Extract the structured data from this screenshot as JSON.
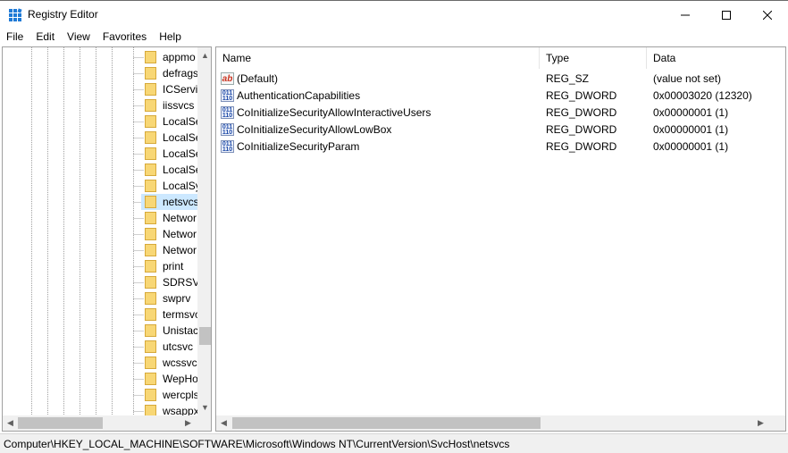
{
  "window": {
    "title": "Registry Editor"
  },
  "menu": [
    "File",
    "Edit",
    "View",
    "Favorites",
    "Help"
  ],
  "tree": {
    "items": [
      {
        "label": "appmo",
        "selected": false
      },
      {
        "label": "defrags",
        "selected": false
      },
      {
        "label": "ICServic",
        "selected": false
      },
      {
        "label": "iissvcs",
        "selected": false
      },
      {
        "label": "LocalSe",
        "selected": false
      },
      {
        "label": "LocalSe",
        "selected": false
      },
      {
        "label": "LocalSe",
        "selected": false
      },
      {
        "label": "LocalSe",
        "selected": false
      },
      {
        "label": "LocalSy",
        "selected": false
      },
      {
        "label": "netsvcs",
        "selected": true
      },
      {
        "label": "Networ",
        "selected": false
      },
      {
        "label": "Networ",
        "selected": false
      },
      {
        "label": "Networ",
        "selected": false
      },
      {
        "label": "print",
        "selected": false
      },
      {
        "label": "SDRSVC",
        "selected": false
      },
      {
        "label": "swprv",
        "selected": false
      },
      {
        "label": "termsvc",
        "selected": false
      },
      {
        "label": "Unistac",
        "selected": false
      },
      {
        "label": "utcsvc",
        "selected": false
      },
      {
        "label": "wcssvc",
        "selected": false
      },
      {
        "label": "WepHo",
        "selected": false
      },
      {
        "label": "wercpls",
        "selected": false
      },
      {
        "label": "wsappx",
        "selected": false
      }
    ]
  },
  "list": {
    "columns": [
      "Name",
      "Type",
      "Data"
    ],
    "rows": [
      {
        "icon": "string-value-icon",
        "name": "(Default)",
        "type": "REG_SZ",
        "data": "(value not set)"
      },
      {
        "icon": "binary-value-icon",
        "name": "AuthenticationCapabilities",
        "type": "REG_DWORD",
        "data": "0x00003020 (12320)"
      },
      {
        "icon": "binary-value-icon",
        "name": "CoInitializeSecurityAllowInteractiveUsers",
        "type": "REG_DWORD",
        "data": "0x00000001 (1)"
      },
      {
        "icon": "binary-value-icon",
        "name": "CoInitializeSecurityAllowLowBox",
        "type": "REG_DWORD",
        "data": "0x00000001 (1)"
      },
      {
        "icon": "binary-value-icon",
        "name": "CoInitializeSecurityParam",
        "type": "REG_DWORD",
        "data": "0x00000001 (1)"
      }
    ]
  },
  "status": {
    "path": "Computer\\HKEY_LOCAL_MACHINE\\SOFTWARE\\Microsoft\\Windows NT\\CurrentVersion\\SvcHost\\netsvcs"
  },
  "colors": {
    "selection": "#cce8ff",
    "folder": "#f8d775"
  }
}
